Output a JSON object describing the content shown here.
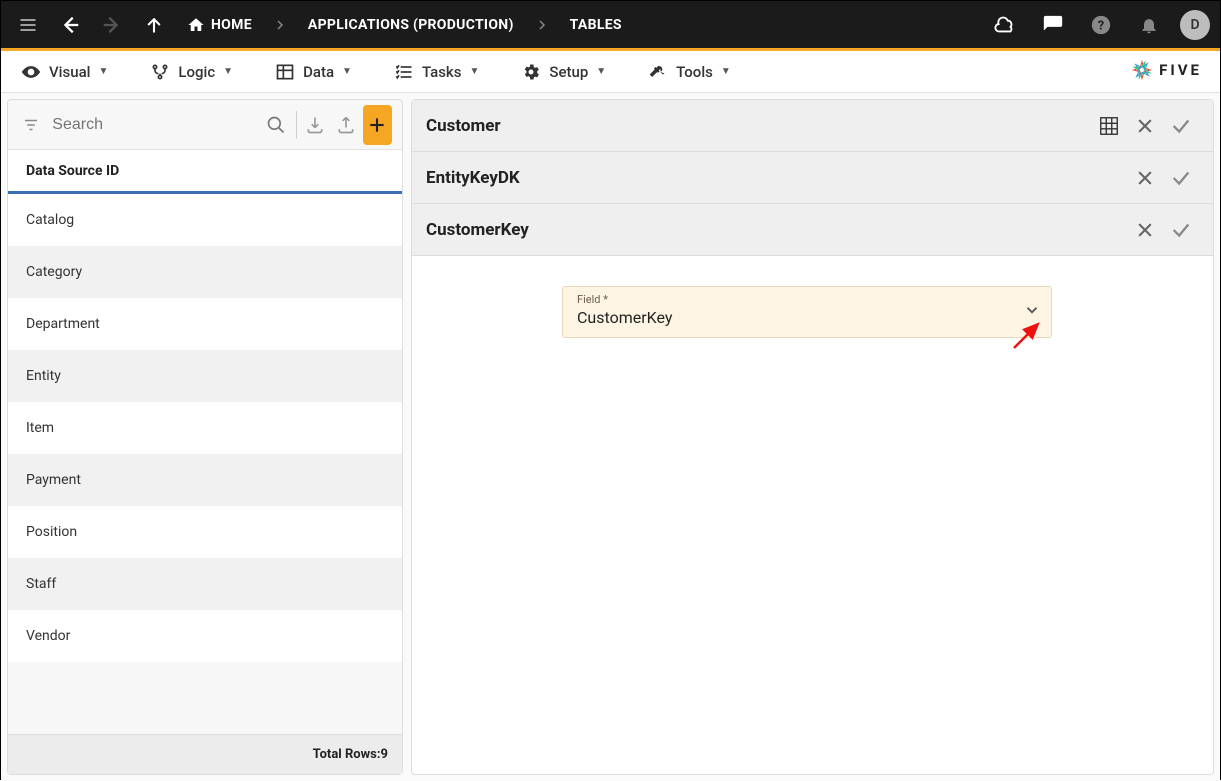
{
  "topbar": {
    "home_label": "HOME",
    "crumb1": "APPLICATIONS (PRODUCTION)",
    "crumb2": "TABLES",
    "avatar_initial": "D"
  },
  "menubar": {
    "items": [
      {
        "label": "Visual"
      },
      {
        "label": "Logic"
      },
      {
        "label": "Data"
      },
      {
        "label": "Tasks"
      },
      {
        "label": "Setup"
      },
      {
        "label": "Tools"
      }
    ],
    "logo_text": "FIVE"
  },
  "sidebar": {
    "search_placeholder": "Search",
    "column_header": "Data Source ID",
    "items": [
      {
        "label": "Catalog"
      },
      {
        "label": "Category"
      },
      {
        "label": "Department"
      },
      {
        "label": "Entity"
      },
      {
        "label": "Item"
      },
      {
        "label": "Payment"
      },
      {
        "label": "Position"
      },
      {
        "label": "Staff"
      },
      {
        "label": "Vendor"
      }
    ],
    "total_label": "Total Rows: ",
    "total_value": "9"
  },
  "detail": {
    "crumbs": [
      {
        "title": "Customer",
        "has_grid_icon": true
      },
      {
        "title": "EntityKeyDK",
        "has_grid_icon": false
      },
      {
        "title": "CustomerKey",
        "has_grid_icon": false
      }
    ],
    "field": {
      "label": "Field *",
      "value": "CustomerKey"
    }
  }
}
